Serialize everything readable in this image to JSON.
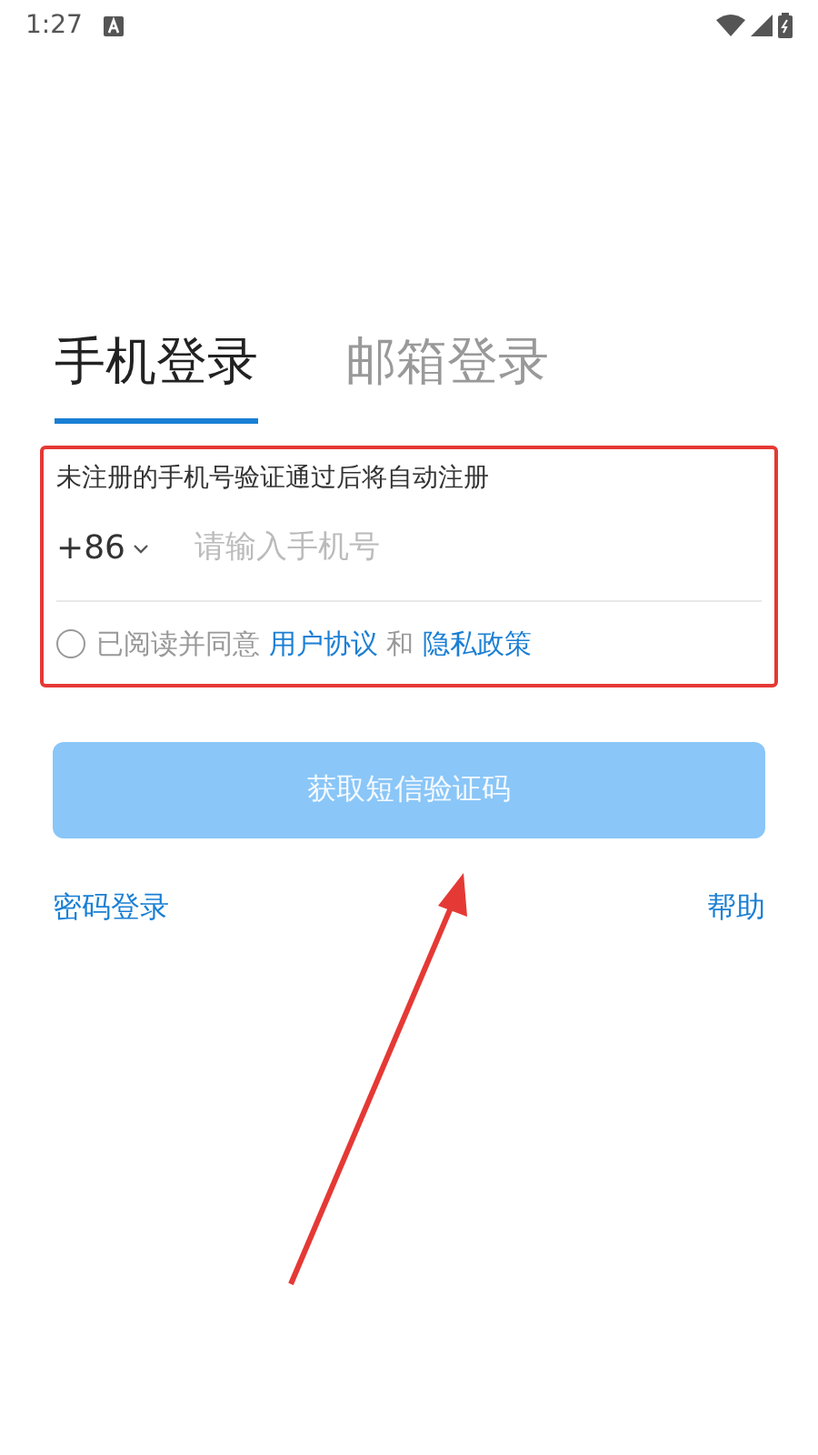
{
  "status_bar": {
    "time": "1:27"
  },
  "tabs": [
    {
      "label": "手机登录",
      "selected": true
    },
    {
      "label": "邮箱登录",
      "selected": false
    }
  ],
  "form": {
    "hint": "未注册的手机号验证通过后将自动注册",
    "country_code": "+86",
    "phone": {
      "placeholder": "请输入手机号"
    },
    "agreement": {
      "checked": false,
      "parts": [
        {
          "kind": "text",
          "text": "已阅读并同意"
        },
        {
          "kind": "link",
          "text": "用户协议"
        },
        {
          "kind": "text",
          "text": "和"
        },
        {
          "kind": "link",
          "text": "隐私政策"
        }
      ]
    }
  },
  "submit": {
    "label": "获取短信验证码",
    "disabled": true
  },
  "links": [
    "密码登录",
    "帮助"
  ]
}
